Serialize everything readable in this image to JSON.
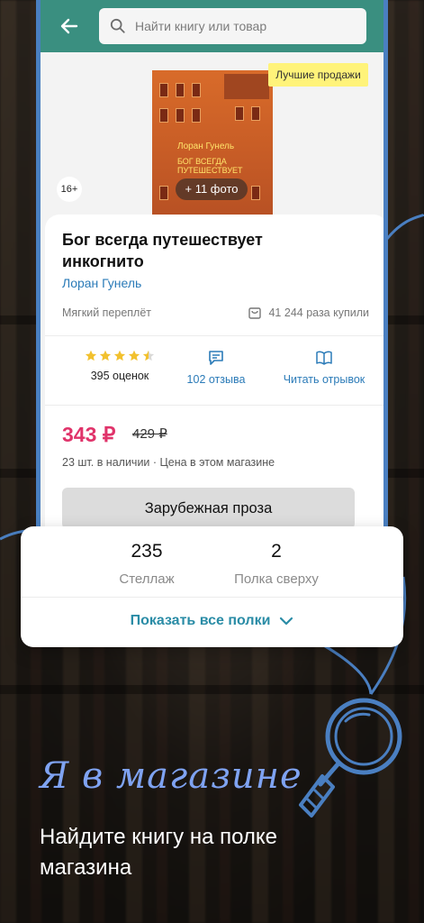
{
  "search": {
    "placeholder": "Найти книгу или товар"
  },
  "cover": {
    "author_line": "Лоран Гунель",
    "title_lines": [
      "БОГ ВСЕГДА",
      "ПУТЕШЕСТВУЕТ"
    ],
    "photos_badge": "+ 11 фото",
    "bestseller_badge": "Лучшие продажи",
    "age_badge": "16+"
  },
  "product": {
    "title": "Бог всегда путешествует инкогнито",
    "author": "Лоран Гунель",
    "binding": "Мягкий переплёт",
    "bought": "41 244 раза купили",
    "rating_value": 4.5,
    "ratings_count": "395 оценок",
    "reviews": "102 отзыва",
    "read_excerpt": "Читать отрывок",
    "price_now": "343 ₽",
    "price_old": "429 ₽",
    "availability": "23 шт. в наличии · Цена в этом магазине",
    "genre_button": "Зарубежная проза"
  },
  "shelf": {
    "rack_number": "235",
    "rack_label": "Стеллаж",
    "shelf_number": "2",
    "shelf_label": "Полка сверху",
    "show_all": "Показать все полки"
  },
  "promo": {
    "title": "Я в магазине",
    "subtitle": "Найдите книгу на полке магазина"
  },
  "colors": {
    "accent_teal": "#3a8f80",
    "price_pink": "#e0336a",
    "link_blue": "#2b7bb8",
    "promo_blue": "#7fa3f2",
    "frame_blue": "#4a7fc1"
  }
}
